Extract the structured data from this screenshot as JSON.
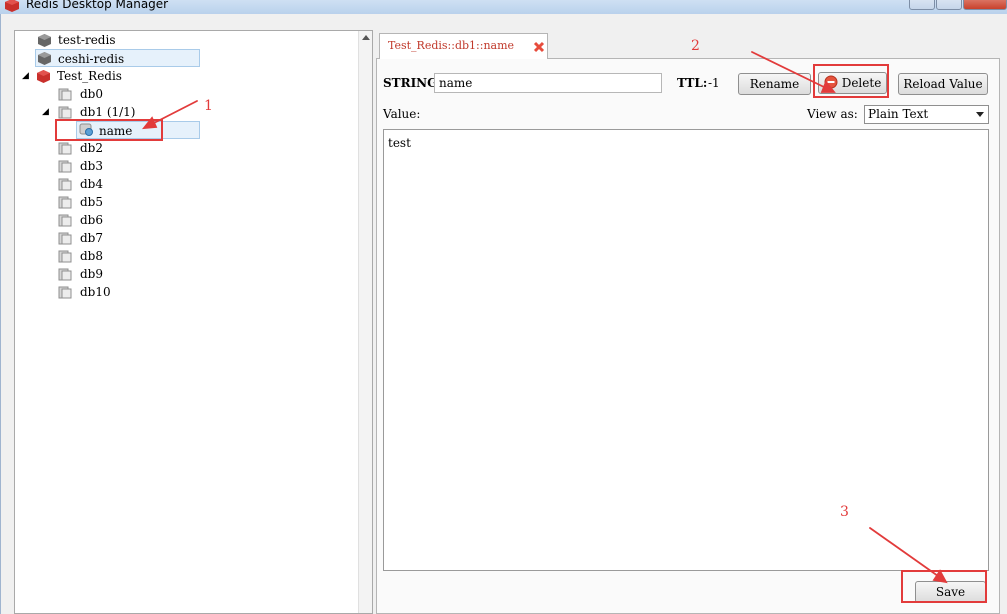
{
  "window": {
    "title": "Redis Desktop Manager"
  },
  "tree": {
    "servers": [
      {
        "label": "test-redis"
      },
      {
        "label": "ceshi-redis"
      },
      {
        "label": "Test_Redis"
      }
    ],
    "databases": [
      "db0",
      "db1 (1/1)",
      "db2",
      "db3",
      "db4",
      "db5",
      "db6",
      "db7",
      "db8",
      "db9",
      "db10"
    ],
    "key": {
      "label": "name"
    }
  },
  "tab": {
    "label": "Test_Redis::db1::name"
  },
  "editor": {
    "type_label": "STRING:",
    "key_value": "name",
    "ttl_label": "TTL:",
    "ttl_value": "-1",
    "rename_label": "Rename",
    "delete_label": "Delete",
    "reload_label": "Reload Value",
    "value_label": "Value:",
    "view_as_label": "View as:",
    "view_as_selected": "Plain Text",
    "value_text": "test",
    "save_label": "Save"
  },
  "annotations": {
    "n1": "1",
    "n2": "2",
    "n3": "3"
  },
  "colors": {
    "annotation": "#e23b3b",
    "tab_text": "#c0392b",
    "server_icon": "#c9302c"
  }
}
